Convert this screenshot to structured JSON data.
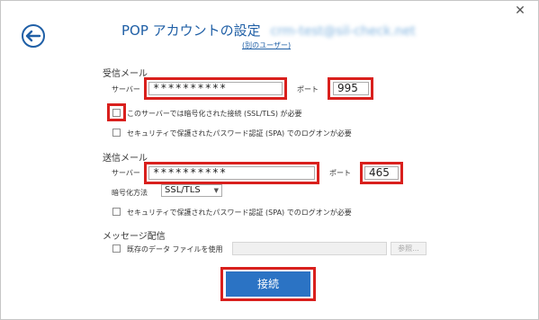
{
  "window": {
    "title": "POP アカウントの設定",
    "email_blurred": "crm-test@sil-check.net",
    "other_user_link": "(別のユーザー)",
    "close_glyph": "✕"
  },
  "incoming": {
    "section_label": "受信メール",
    "server_label": "サーバー",
    "server_value": "**********",
    "port_label": "ポート",
    "port_value": "995",
    "ssl_checkbox_label": "このサーバーでは暗号化された接続 (SSL/TLS) が必要",
    "ssl_checked": false,
    "spa_checkbox_label": "セキュリティで保護されたパスワード認証 (SPA) でのログオンが必要",
    "spa_checked": false
  },
  "outgoing": {
    "section_label": "送信メール",
    "server_label": "サーバー",
    "server_value": "**********",
    "port_label": "ポート",
    "port_value": "465",
    "encryption_label": "暗号化方法",
    "encryption_value": "SSL/TLS",
    "spa_checkbox_label": "セキュリティで保護されたパスワード認証 (SPA) でのログオンが必要",
    "spa_checked": false
  },
  "delivery": {
    "section_label": "メッセージ配信",
    "existing_file_label": "既存のデータ ファイルを使用",
    "existing_file_checked": false,
    "path_value": "",
    "browse_label": "参照..."
  },
  "connect_button": "接続",
  "colors": {
    "accent": "#2b73c4",
    "highlight": "#d9201d",
    "title": "#1f5fa6"
  }
}
